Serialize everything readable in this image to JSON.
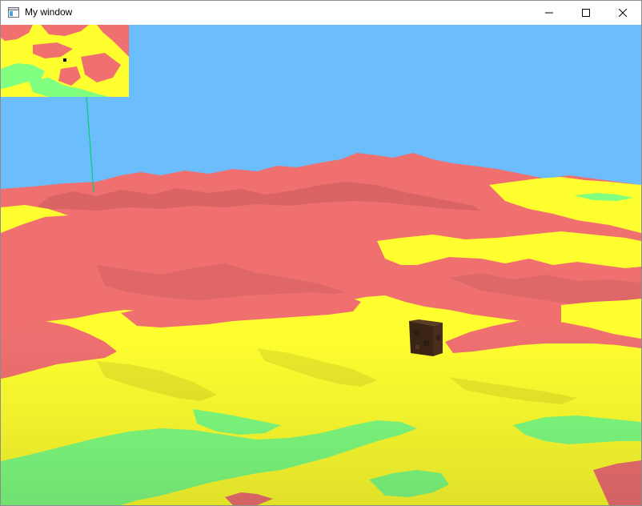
{
  "window": {
    "title": "My window",
    "controls": {
      "minimize_icon": "minimize-icon",
      "maximize_icon": "maximize-icon",
      "close_icon": "close-icon"
    }
  },
  "scene": {
    "colors": {
      "sky": "#6bbdfb",
      "high_terrain": "#f07070",
      "mid_terrain": "#ffff30",
      "low_terrain": "#80ff80",
      "marker_line": "#00d070",
      "cube": "#4a2e1c"
    }
  }
}
